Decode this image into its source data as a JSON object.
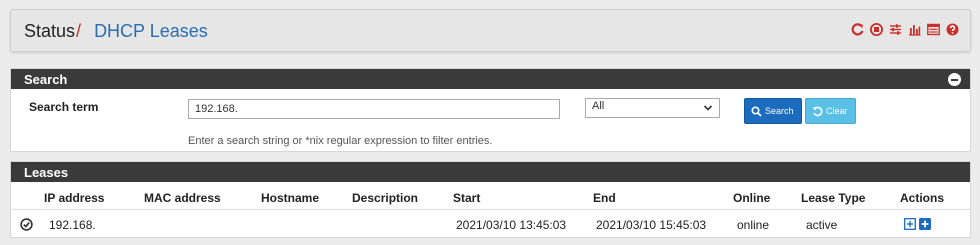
{
  "breadcrumb": {
    "section": "Status",
    "separator": "/",
    "page": "DHCP Leases"
  },
  "header_icons": [
    "restart-service-icon",
    "stop-service-icon",
    "settings-sliders-icon",
    "status-graph-icon",
    "log-list-icon",
    "help-icon"
  ],
  "search_panel": {
    "title": "Search",
    "term_label": "Search term",
    "term_value": "192.168.",
    "filter_selected": "All",
    "search_button_label": "Search",
    "clear_button_label": "Clear",
    "help_text": "Enter a search string or *nix regular expression to filter entries."
  },
  "leases_panel": {
    "title": "Leases",
    "columns": [
      "IP address",
      "MAC address",
      "Hostname",
      "Description",
      "Start",
      "End",
      "Online",
      "Lease Type",
      "Actions"
    ],
    "rows": [
      {
        "ip": "192.168.",
        "mac": "",
        "hostname": "",
        "description": "",
        "start": "2021/03/10 13:45:03",
        "end": "2021/03/10 15:45:03",
        "online": "online",
        "lease_type": "active"
      }
    ]
  },
  "colors": {
    "accent_red": "#c9302c",
    "link_blue": "#2a6db0",
    "panel_header": "#3a3a3a",
    "primary_button": "#1b6bbf",
    "info_button": "#5ac0e6"
  }
}
